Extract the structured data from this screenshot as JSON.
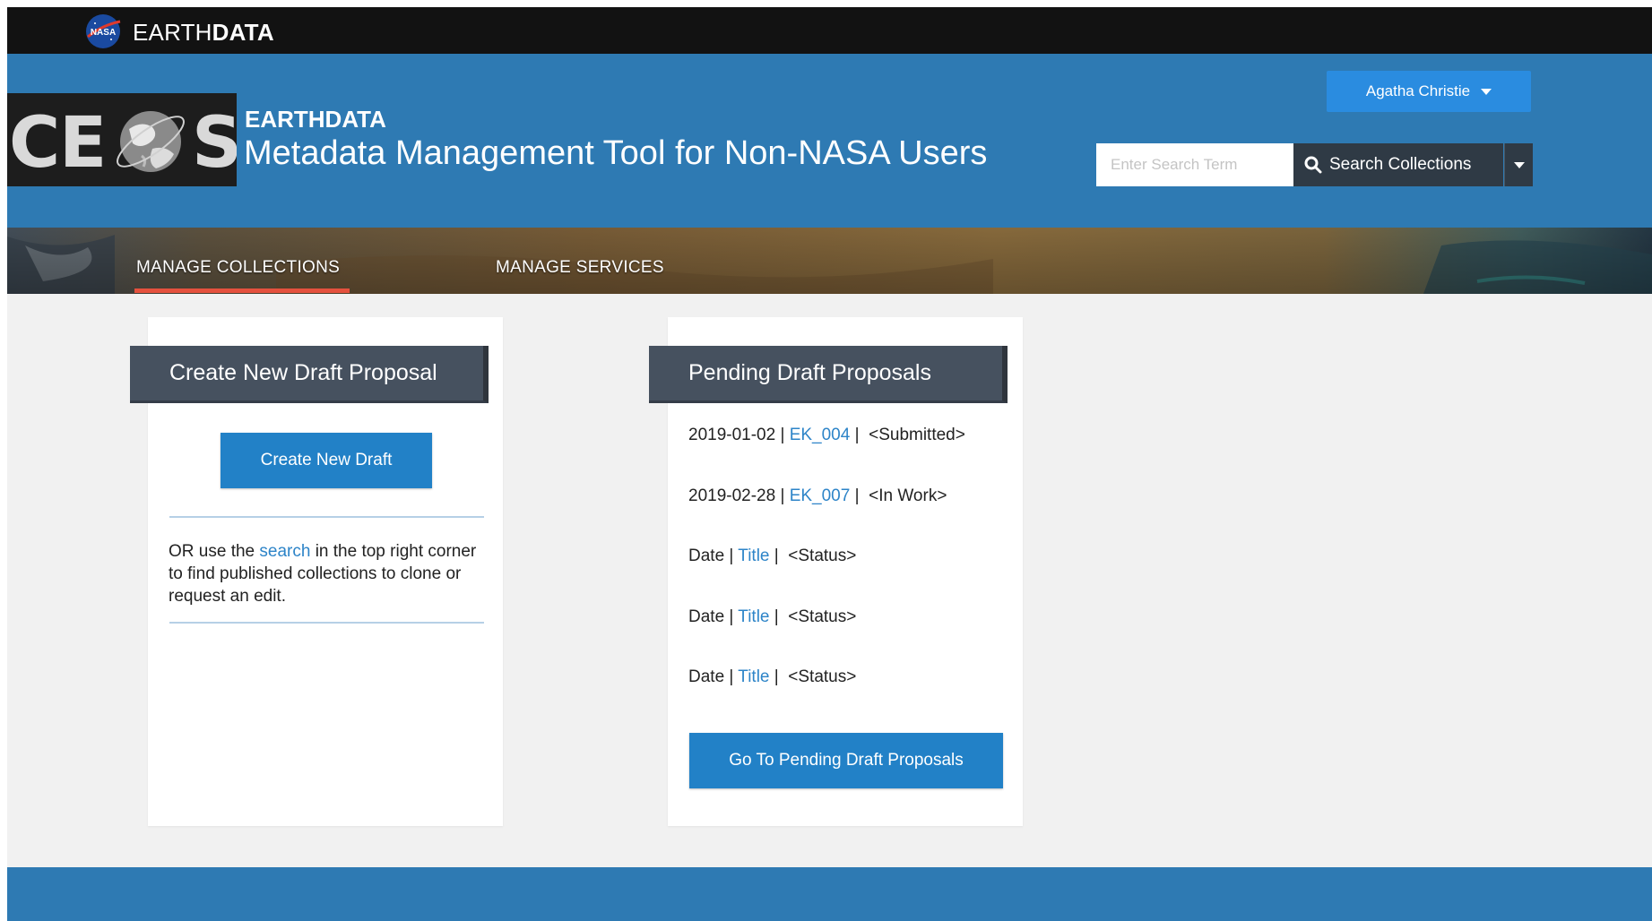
{
  "topbar": {
    "brand_prefix": "EARTH",
    "brand_suffix": "DATA"
  },
  "header": {
    "logo_text": "CEOS",
    "app_name": "EARTHDATA",
    "app_subtitle": "Metadata Management Tool for Non-NASA Users",
    "user_menu_label": "Agatha Christie",
    "search": {
      "placeholder": "Enter Search Term",
      "button_label": "Search Collections"
    }
  },
  "nav": {
    "tabs": [
      {
        "label": "MANAGE COLLECTIONS",
        "active": true
      },
      {
        "label": "MANAGE SERVICES",
        "active": false
      }
    ]
  },
  "create_card": {
    "title": "Create New Draft Proposal",
    "button_label": "Create New Draft",
    "help_prefix": "OR use the ",
    "help_link": "search",
    "help_suffix": " in the top right corner to find published collections to clone or request an edit."
  },
  "pending_card": {
    "title": "Pending Draft Proposals",
    "rows": [
      {
        "date": "2019-01-02",
        "title": "EK_004",
        "status": "<Submitted>"
      },
      {
        "date": "2019-02-28",
        "title": "EK_007",
        "status": "<In Work>"
      },
      {
        "date": "Date",
        "title": "Title",
        "status": "<Status>"
      },
      {
        "date": "Date",
        "title": "Title",
        "status": "<Status>"
      },
      {
        "date": "Date",
        "title": "Title",
        "status": "<Status>"
      }
    ],
    "button_label": "Go To Pending Draft Proposals"
  },
  "colors": {
    "header_blue": "#2e7ab3",
    "button_blue": "#2281c7",
    "link_blue": "#2d84c8",
    "banner_gray": "#46515f",
    "active_tab_accent": "#e5513e"
  },
  "icons": {
    "nasa_logo": "nasa-meatball-logo",
    "search": "search-icon",
    "caret": "caret-down-icon",
    "globe": "globe-icon"
  }
}
